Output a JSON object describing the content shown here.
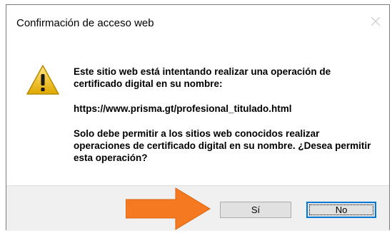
{
  "dialog": {
    "title": "Confirmación de acceso web",
    "message_line1": "Este sitio web está intentando realizar una operación de certificado digital en su nombre:",
    "url": "https://www.prisma.gt/profesional_titulado.html",
    "message_line2": "Solo debe permitir a los sitios web conocidos realizar operaciones de certificado digital en su nombre. ¿Desea permitir esta operación?"
  },
  "buttons": {
    "yes_label": "Sí",
    "no_label": "No"
  },
  "icons": {
    "warning": "warning-icon",
    "close": "close-icon",
    "arrow": "arrow-right-icon"
  },
  "colors": {
    "arrow": "#f47920",
    "warning_yellow": "#f4c430",
    "footer_bg": "#f0f0f0",
    "focus_border": "#0078d7"
  }
}
